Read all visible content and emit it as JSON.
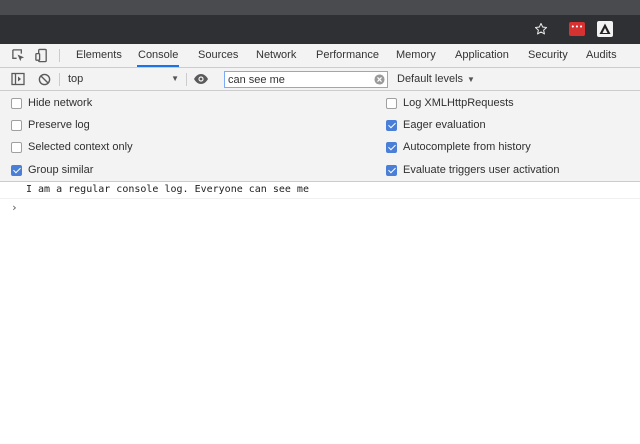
{
  "browser": {
    "star_icon": "star-icon",
    "extension_icons": [
      "password-manager-icon",
      "triangle-logo-icon"
    ],
    "extension_badge_text": "•••"
  },
  "devtools": {
    "tool_icons": [
      "inspect-element-icon",
      "device-toolbar-icon"
    ],
    "tabs": [
      {
        "label": "Elements",
        "active": false
      },
      {
        "label": "Console",
        "active": true
      },
      {
        "label": "Sources",
        "active": false
      },
      {
        "label": "Network",
        "active": false
      },
      {
        "label": "Performance",
        "active": false
      },
      {
        "label": "Memory",
        "active": false
      },
      {
        "label": "Application",
        "active": false
      },
      {
        "label": "Security",
        "active": false
      },
      {
        "label": "Audits",
        "active": false
      }
    ],
    "active_tab_color": "#1a73e8"
  },
  "console_toolbar": {
    "context": "top",
    "filter_value": "can see me",
    "levels": "Default levels"
  },
  "settings": {
    "left": [
      {
        "label": "Hide network",
        "checked": false
      },
      {
        "label": "Preserve log",
        "checked": false
      },
      {
        "label": "Selected context only",
        "checked": false
      },
      {
        "label": "Group similar",
        "checked": true
      }
    ],
    "right": [
      {
        "label": "Log XMLHttpRequests",
        "checked": false
      },
      {
        "label": "Eager evaluation",
        "checked": true
      },
      {
        "label": "Autocomplete from history",
        "checked": true
      },
      {
        "label": "Evaluate triggers user activation",
        "checked": true
      }
    ],
    "checkbox_color": "#4a7fd8"
  },
  "console": {
    "messages": [
      {
        "text": "I am a regular console log. Everyone can see me"
      }
    ],
    "prompt_symbol": "›"
  }
}
